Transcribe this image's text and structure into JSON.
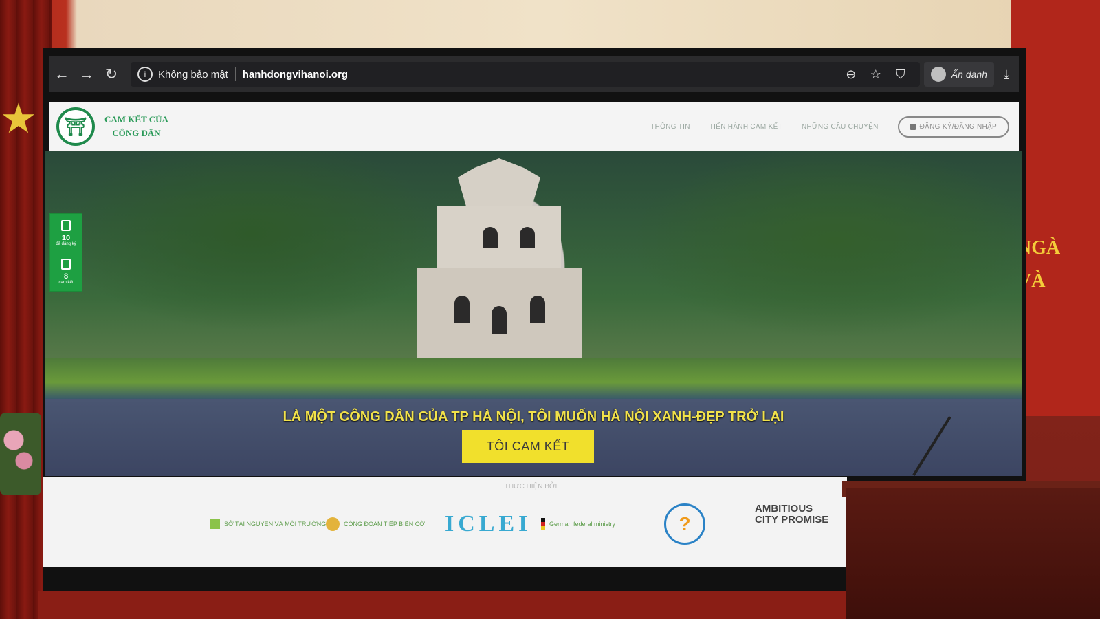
{
  "room": {
    "banner_lines": [
      "NGÀ",
      "VÀ"
    ]
  },
  "browser": {
    "security_label": "Không bảo mật",
    "url": "hanhdongvihanoi.org",
    "profile_label": "Ẩn danh",
    "icons": [
      "back-arrow-icon",
      "forward-arrow-icon",
      "reload-icon",
      "info-icon",
      "zoom-out-icon",
      "star-icon",
      "shield-icon",
      "profile-avatar-icon",
      "download-icon"
    ]
  },
  "site": {
    "logo_line1": "CAM KẾT CỦA",
    "logo_line2": "CÔNG DÂN",
    "nav": [
      "THÔNG TIN",
      "TIẾN HÀNH CAM KẾT",
      "NHỮNG CÂU CHUYỆN"
    ],
    "login_label": "ĐĂNG KÝ/ĐĂNG NHẬP"
  },
  "side_widget": {
    "items": [
      {
        "value": "10",
        "label": "đã đăng ký"
      },
      {
        "value": "8",
        "label": "cam kết"
      }
    ]
  },
  "hero": {
    "headline": "LÀ MỘT CÔNG DÂN CỦA TP HÀ NỘI, TÔI MUỐN HÀ NỘI XANH-ĐẸP TRỞ LẠI",
    "cta_label": "TÔI CAM KẾT"
  },
  "partners": {
    "title": "THỰC HIỆN BỞI",
    "logos": [
      {
        "name": "SỞ TÀI NGUYÊN VÀ MÔI TRƯỜNG"
      },
      {
        "name": "CÔNG ĐOÀN TIẾP BIẾN CỜ"
      },
      {
        "name": "ICLEI"
      },
      {
        "name": "German federal ministry"
      },
      {
        "name": "city-emblem"
      },
      {
        "name": "AMBITIOUS",
        "name2": "CITY PROMISE"
      }
    ]
  }
}
